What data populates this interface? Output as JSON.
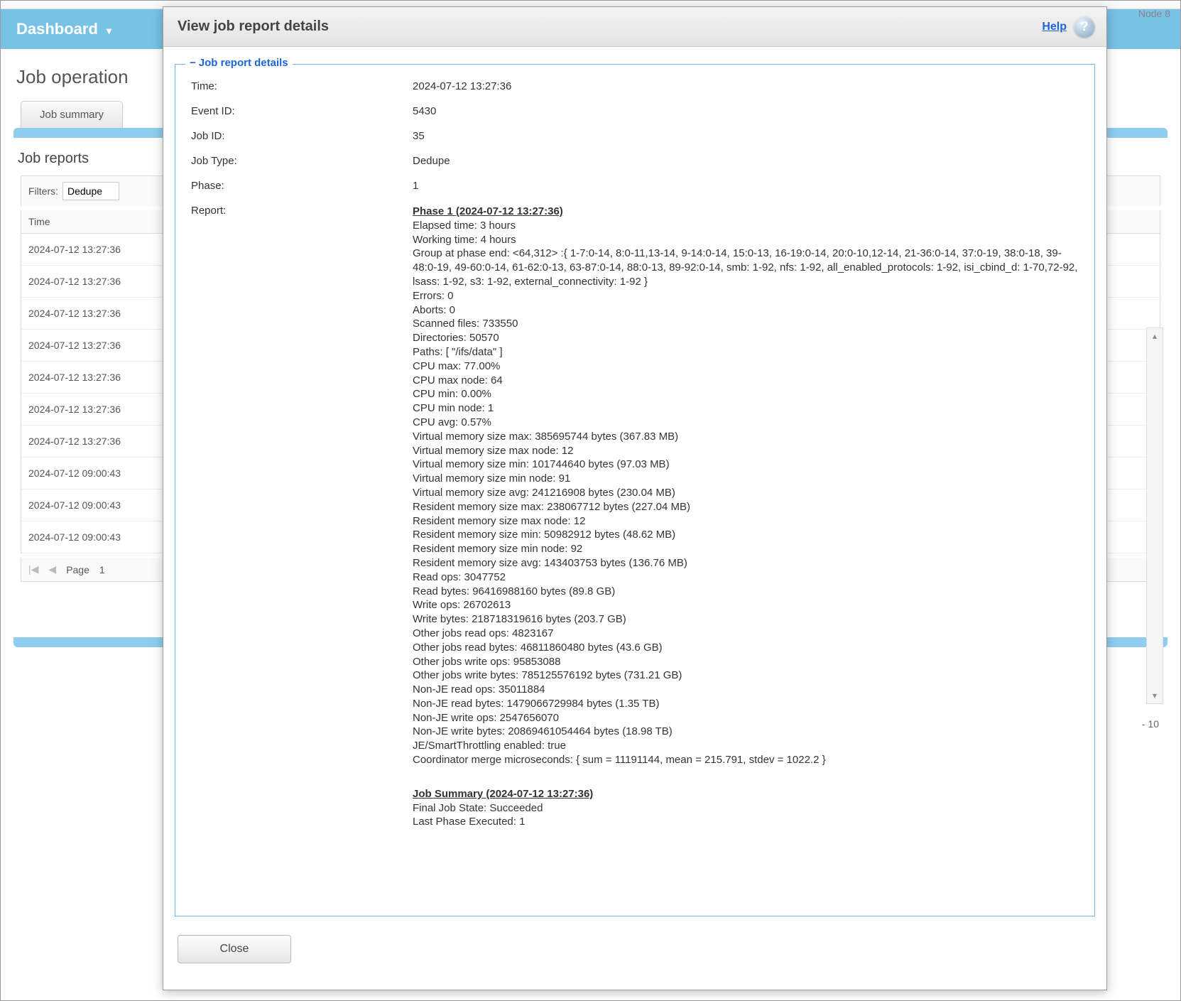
{
  "topbar": {
    "node": "Node 8"
  },
  "navbar": {
    "dashboard": "Dashboard"
  },
  "page": {
    "title": "Job operation",
    "tab_summary": "Job summary",
    "section_title": "Job reports",
    "filters_label": "Filters:",
    "filters_value": "Dedupe",
    "col_time": "Time",
    "page_label": "Page",
    "page_num": "1",
    "page_size": "- 10",
    "rows": [
      "2024-07-12 13:27:36",
      "2024-07-12 13:27:36",
      "2024-07-12 13:27:36",
      "2024-07-12 13:27:36",
      "2024-07-12 13:27:36",
      "2024-07-12 13:27:36",
      "2024-07-12 13:27:36",
      "2024-07-12 09:00:43",
      "2024-07-12 09:00:43",
      "2024-07-12 09:00:43"
    ]
  },
  "modal": {
    "title": "View job report details",
    "help": "Help",
    "legend": "Job report details",
    "close": "Close",
    "labels": {
      "time": "Time:",
      "event_id": "Event ID:",
      "job_id": "Job ID:",
      "job_type": "Job Type:",
      "phase": "Phase:",
      "report": "Report:"
    },
    "values": {
      "time": "2024-07-12 13:27:36",
      "event_id": "5430",
      "job_id": "35",
      "job_type": "Dedupe",
      "phase": "1"
    },
    "report": {
      "phase_header": "Phase 1 (2024-07-12 13:27:36)",
      "elapsed": "Elapsed time: 3 hours",
      "working": "Working time: 4 hours",
      "group": "Group at phase end: <64,312> :{ 1-7:0-14, 8:0-11,13-14, 9-14:0-14, 15:0-13, 16-19:0-14, 20:0-10,12-14, 21-36:0-14, 37:0-19, 38:0-18, 39-48:0-19, 49-60:0-14, 61-62:0-13, 63-87:0-14, 88:0-13, 89-92:0-14, smb: 1-92, nfs: 1-92, all_enabled_protocols: 1-92, isi_cbind_d: 1-70,72-92, lsass: 1-92, s3: 1-92, external_connectivity: 1-92 }",
      "errors": "Errors: 0",
      "aborts": "Aborts: 0",
      "scanned": "Scanned files: 733550",
      "dirs": "Directories: 50570",
      "paths": "Paths: [ \"/ifs/data\" ]",
      "cpu_max": "CPU max: 77.00%",
      "cpu_max_node": "CPU max node: 64",
      "cpu_min": "CPU min: 0.00%",
      "cpu_min_node": "CPU min node: 1",
      "cpu_avg": "CPU avg: 0.57%",
      "vm_max": "Virtual memory size max: 385695744 bytes (367.83 MB)",
      "vm_max_node": "Virtual memory size max node: 12",
      "vm_min": "Virtual memory size min: 101744640 bytes (97.03 MB)",
      "vm_min_node": "Virtual memory size min node: 91",
      "vm_avg": "Virtual memory size avg: 241216908 bytes (230.04 MB)",
      "rm_max": "Resident memory size max: 238067712 bytes (227.04 MB)",
      "rm_max_node": "Resident memory size max node: 12",
      "rm_min": "Resident memory size min: 50982912 bytes (48.62 MB)",
      "rm_min_node": "Resident memory size min node: 92",
      "rm_avg": "Resident memory size avg: 143403753 bytes (136.76 MB)",
      "read_ops": "Read ops: 3047752",
      "read_bytes": "Read bytes: 96416988160 bytes (89.8 GB)",
      "write_ops": "Write ops: 26702613",
      "write_bytes": "Write bytes: 218718319616 bytes (203.7 GB)",
      "oj_read_ops": "Other jobs read ops: 4823167",
      "oj_read_bytes": "Other jobs read bytes: 46811860480 bytes (43.6 GB)",
      "oj_write_ops": "Other jobs write ops: 95853088",
      "oj_write_bytes": "Other jobs write bytes: 785125576192 bytes (731.21 GB)",
      "nje_read_ops": "Non-JE read ops: 35011884",
      "nje_read_bytes": "Non-JE read bytes: 1479066729984 bytes (1.35 TB)",
      "nje_write_ops": "Non-JE write ops: 2547656070",
      "nje_write_bytes": "Non-JE write bytes: 20869461054464 bytes (18.98 TB)",
      "throttling": "JE/SmartThrottling enabled: true",
      "coord": "Coordinator merge microseconds: { sum = 11191144, mean = 215.791, stdev = 1022.2 }",
      "summary_header": "Job Summary (2024-07-12 13:27:36)",
      "final_state": "Final Job State: Succeeded",
      "last_phase": "Last Phase Executed: 1"
    }
  }
}
